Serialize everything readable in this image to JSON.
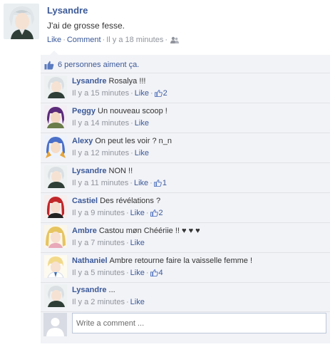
{
  "post": {
    "author": "Lysandre",
    "text": "J'ai de grosse fesse.",
    "like_label": "Like",
    "comment_label": "Comment",
    "time": "Il y a 18 minutes"
  },
  "likes": {
    "text": "6 personnes aiment ça."
  },
  "comments": [
    {
      "author": "Lysandre",
      "text": "Rosalya !!!",
      "time": "Il y a 15 minutes",
      "like_label": "Like",
      "like_count": "2"
    },
    {
      "author": "Peggy",
      "text": "Un nouveau scoop !",
      "time": "Il y a 14 minutes",
      "like_label": "Like",
      "like_count": ""
    },
    {
      "author": "Alexy",
      "text": "On peut les voir ? n_n",
      "time": "Il y a 12 minutes",
      "like_label": "Like",
      "like_count": ""
    },
    {
      "author": "Lysandre",
      "text": "NON !!",
      "time": "Il y a 11 minutes",
      "like_label": "Like",
      "like_count": "1"
    },
    {
      "author": "Castiel",
      "text": "Des révélations ?",
      "time": "Il y a 9 minutes",
      "like_label": "Like",
      "like_count": "2"
    },
    {
      "author": "Ambre",
      "text": "Castou møn Chéériie !! ♥ ♥ ♥",
      "time": "Il y a 7 minutes",
      "like_label": "Like",
      "like_count": ""
    },
    {
      "author": "Nathaniel",
      "text": "Ambre retourne faire la vaisselle femme !",
      "time": "Il y a 5 minutes",
      "like_label": "Like",
      "like_count": "4"
    },
    {
      "author": "Lysandre",
      "text": "...",
      "time": "Il y a 2 minutes",
      "like_label": "Like",
      "like_count": ""
    }
  ],
  "write": {
    "placeholder": "Write a comment ..."
  },
  "colors": {
    "link": "#3b5998",
    "panel": "#f2f3f7",
    "meta": "#90949c"
  },
  "icons": {
    "like": "thumbs-up-icon",
    "audience": "friends-icon"
  }
}
